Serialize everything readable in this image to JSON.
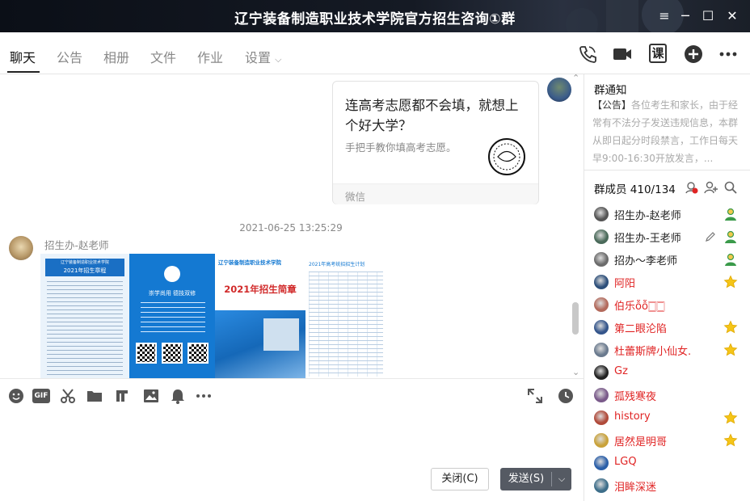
{
  "window": {
    "title": "辽宁装备制造职业技术学院官方招生咨询①群"
  },
  "tabs": [
    "聊天",
    "公告",
    "相册",
    "文件",
    "作业",
    "设置"
  ],
  "header_icons": [
    "phone-icon",
    "video-icon",
    "class-icon",
    "add-icon",
    "more-icon"
  ],
  "header_icons_text": {
    "class": "课"
  },
  "chat": {
    "card": {
      "title": "连高考志愿都不会填，就想上个好大学？",
      "subtitle": "手把手教你填高考志愿。",
      "footer": "微信"
    },
    "timestamp": "2021-06-25 13:25:29",
    "sender": "招生办-赵老师",
    "poster": {
      "panel1_title": "辽宁装备制造职业技术学院",
      "panel1_sub": "2021年招生章程",
      "panel2_slogan": "崇学尚用  德技双修",
      "panel3_title": "辽宁装备制造职业技术学院",
      "panel3_sub": "2021年招生简章",
      "panel4_title": "2021年高考统招招生计划"
    }
  },
  "toolbar": {
    "icons": [
      "emoji-icon",
      "gif-icon",
      "scissors-icon",
      "folder-icon",
      "music-icon",
      "image-icon",
      "bell-icon",
      "more-icon",
      "expand-icon",
      "history-icon"
    ],
    "gif_label": "GIF",
    "close_label": "关闭(C)",
    "send_label": "发送(S)"
  },
  "notice": {
    "title": "群通知",
    "label": "【公告】",
    "text": "各位考生和家长，由于经常有不法分子发送违规信息，本群从即日起分时段禁言，工作日每天早9:00-16:30开放发言，..."
  },
  "members": {
    "title": "群成员 410/134",
    "list": [
      {
        "name": "招生办-赵老师",
        "badge": "admin-icon",
        "color": "#222"
      },
      {
        "name": "招生办-王老师",
        "badge": "admin-icon",
        "color": "#222"
      },
      {
        "name": "招办～李老师",
        "badge": "admin-icon",
        "color": "#222"
      },
      {
        "name": "阿阳",
        "badge": "star-icon",
        "color": "#e02424"
      },
      {
        "name": "伯乐ỗỗ🀆🀆",
        "badge": "",
        "color": "#e02424"
      },
      {
        "name": "第二眼沦陷",
        "badge": "star-icon",
        "color": "#e02424"
      },
      {
        "name": "杜蕾斯牌小仙女.",
        "badge": "star-icon",
        "color": "#e02424"
      },
      {
        "name": "Gz",
        "badge": "",
        "color": "#e02424"
      },
      {
        "name": "孤残寒夜",
        "badge": "",
        "color": "#e02424"
      },
      {
        "name": "history",
        "badge": "star-icon",
        "color": "#e02424"
      },
      {
        "name": "居然是明哥",
        "badge": "star-icon",
        "color": "#e02424"
      },
      {
        "name": "LGQ",
        "badge": "",
        "color": "#e02424"
      },
      {
        "name": "泪眸深迷",
        "badge": "",
        "color": "#e02424"
      }
    ]
  }
}
